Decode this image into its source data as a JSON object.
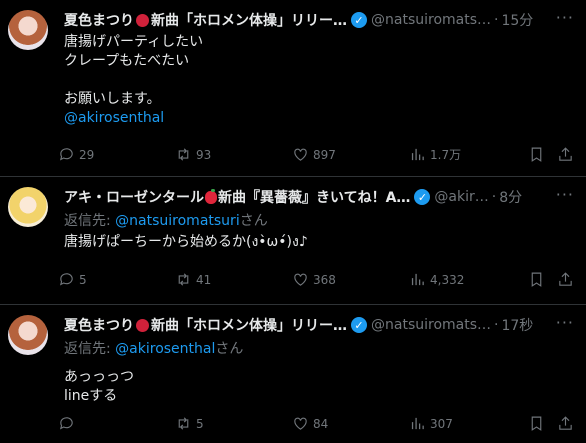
{
  "tweets": [
    {
      "name": "夏色まつり",
      "name_suffix": "新曲「ホロメン体操」リリー…",
      "handle": "@natsuiromats…",
      "time": "15分",
      "reply_prefix": "",
      "reply_handle": "",
      "reply_suffix": "",
      "lines": [
        "唐揚げパーティしたい",
        "クレープもたべたい",
        "",
        "お願いします。"
      ],
      "mention_line": "@akirosenthal",
      "stats": {
        "replies": "29",
        "retweets": "93",
        "likes": "897",
        "views": "1.7万"
      }
    },
    {
      "name": "アキ・ローゼンタール",
      "name_suffix": "新曲『異薔薇』きいてね！A…",
      "handle": "@akir…",
      "time": "8分",
      "reply_prefix": "返信先: ",
      "reply_handle": "@natsuiromatsuri",
      "reply_suffix": "さん",
      "lines": [
        "唐揚げぱーちーから始めるか(ง•̀ω•́)ง♪"
      ],
      "mention_line": "",
      "stats": {
        "replies": "5",
        "retweets": "41",
        "likes": "368",
        "views": "4,332"
      }
    },
    {
      "name": "夏色まつり",
      "name_suffix": "新曲「ホロメン体操」リリー…",
      "handle": "@natsuiromats…",
      "time": "17秒",
      "reply_prefix": "返信先: ",
      "reply_handle": "@akirosenthal",
      "reply_suffix": "さん",
      "lines": [
        "あっっっつ",
        "lineする"
      ],
      "mention_line": "",
      "stats": {
        "replies": "",
        "retweets": "5",
        "likes": "84",
        "views": "307"
      }
    }
  ],
  "separator": "·",
  "verified_mark": "✓",
  "more_label": "···",
  "colors": {
    "accent": "#1d9bf0",
    "muted": "#71767b",
    "text": "#e7e9ea",
    "background": "#000000"
  }
}
